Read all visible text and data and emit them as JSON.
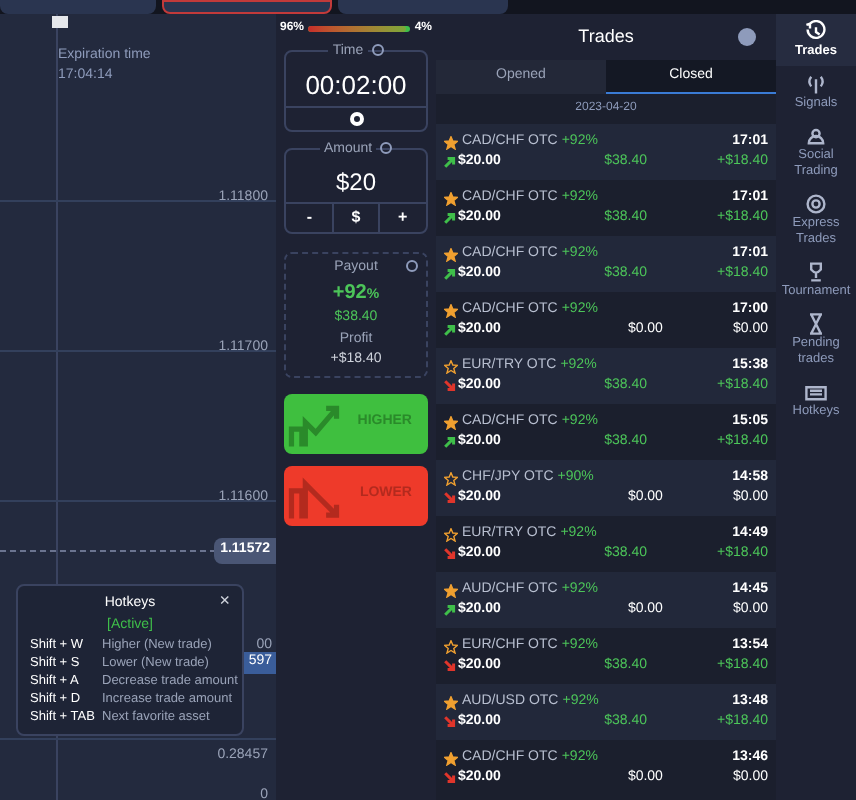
{
  "chart": {
    "expiration_label": "Expiration time",
    "expiration_time": "17:04:14",
    "price_labels": [
      "1.11800",
      "1.11700",
      "1.11600"
    ],
    "current_price": "1.11572",
    "covered_label": "00",
    "covered_tag": "597",
    "lower_scale": [
      "0.28457",
      "0"
    ]
  },
  "sentiment": {
    "down": "96%",
    "up": "4%",
    "level": 0.96
  },
  "time": {
    "label": "Time",
    "value": "00:02:00"
  },
  "amount": {
    "label": "Amount",
    "value": "$20",
    "minus": "-",
    "currency": "$",
    "plus": "+"
  },
  "payout": {
    "label": "Payout",
    "percent": "+92",
    "percent_sign": "%",
    "value": "$38.40",
    "profit_label": "Profit",
    "profit": "+$18.40"
  },
  "buttons": [
    {
      "kind": "higher",
      "label": "HIGHER"
    },
    {
      "kind": "lower",
      "label": "LOWER"
    }
  ],
  "hotkeys": {
    "title": "Hotkeys",
    "status": "[Active]",
    "close": "×",
    "items": [
      {
        "keys": "Shift + W",
        "action": "Higher (New trade)"
      },
      {
        "keys": "Shift + S",
        "action": "Lower (New trade)"
      },
      {
        "keys": "Shift + A",
        "action": "Decrease trade amount"
      },
      {
        "keys": "Shift + D",
        "action": "Increase trade amount"
      },
      {
        "keys": "Shift + TAB",
        "action": "Next favorite asset"
      }
    ]
  },
  "trades": {
    "title": "Trades",
    "tabs": [
      {
        "label": "Opened",
        "selected": false
      },
      {
        "label": "Closed",
        "selected": true
      }
    ],
    "date": "2023-04-20",
    "rows": [
      {
        "asset": "CAD/CHF OTC",
        "payout": "+92%",
        "favorite": true,
        "rising": true,
        "amount": "$20.00",
        "value": "$38.40",
        "time": "17:01",
        "profit": "+$18.40",
        "won": true
      },
      {
        "asset": "CAD/CHF OTC",
        "payout": "+92%",
        "favorite": true,
        "rising": true,
        "amount": "$20.00",
        "value": "$38.40",
        "time": "17:01",
        "profit": "+$18.40",
        "won": true
      },
      {
        "asset": "CAD/CHF OTC",
        "payout": "+92%",
        "favorite": true,
        "rising": true,
        "amount": "$20.00",
        "value": "$38.40",
        "time": "17:01",
        "profit": "+$18.40",
        "won": true
      },
      {
        "asset": "CAD/CHF OTC",
        "payout": "+92%",
        "favorite": true,
        "rising": true,
        "amount": "$20.00",
        "value": "$0.00",
        "time": "17:00",
        "profit": "$0.00",
        "won": false
      },
      {
        "asset": "EUR/TRY OTC",
        "payout": "+92%",
        "favorite": false,
        "rising": false,
        "amount": "$20.00",
        "value": "$38.40",
        "time": "15:38",
        "profit": "+$18.40",
        "won": true
      },
      {
        "asset": "CAD/CHF OTC",
        "payout": "+92%",
        "favorite": true,
        "rising": true,
        "amount": "$20.00",
        "value": "$38.40",
        "time": "15:05",
        "profit": "+$18.40",
        "won": true
      },
      {
        "asset": "CHF/JPY OTC",
        "payout": "+90%",
        "favorite": false,
        "rising": false,
        "amount": "$20.00",
        "value": "$0.00",
        "time": "14:58",
        "profit": "$0.00",
        "won": false
      },
      {
        "asset": "EUR/TRY OTC",
        "payout": "+92%",
        "favorite": false,
        "rising": false,
        "amount": "$20.00",
        "value": "$38.40",
        "time": "14:49",
        "profit": "+$18.40",
        "won": true
      },
      {
        "asset": "AUD/CHF OTC",
        "payout": "+92%",
        "favorite": true,
        "rising": true,
        "amount": "$20.00",
        "value": "$0.00",
        "time": "14:45",
        "profit": "$0.00",
        "won": false
      },
      {
        "asset": "EUR/CHF OTC",
        "payout": "+92%",
        "favorite": false,
        "rising": false,
        "amount": "$20.00",
        "value": "$38.40",
        "time": "13:54",
        "profit": "+$18.40",
        "won": true
      },
      {
        "asset": "AUD/USD OTC",
        "payout": "+92%",
        "favorite": true,
        "rising": false,
        "amount": "$20.00",
        "value": "$38.40",
        "time": "13:48",
        "profit": "+$18.40",
        "won": true
      },
      {
        "asset": "CAD/CHF OTC",
        "payout": "+92%",
        "favorite": true,
        "rising": false,
        "amount": "$20.00",
        "value": "$0.00",
        "time": "13:46",
        "profit": "$0.00",
        "won": false
      }
    ]
  },
  "sidebar": {
    "items": [
      {
        "kind": "trades",
        "label": "Trades",
        "selected": true
      },
      {
        "kind": "signals",
        "label": "Signals",
        "selected": false
      },
      {
        "kind": "social",
        "label": "Social Trading",
        "selected": false
      },
      {
        "kind": "express",
        "label": "Express Trades",
        "selected": false
      },
      {
        "kind": "tournaments",
        "label": "Tournament",
        "selected": false
      },
      {
        "kind": "pending",
        "label": "Pending trades",
        "selected": false
      },
      {
        "kind": "hotkeys",
        "label": "Hotkeys",
        "selected": false
      }
    ]
  }
}
